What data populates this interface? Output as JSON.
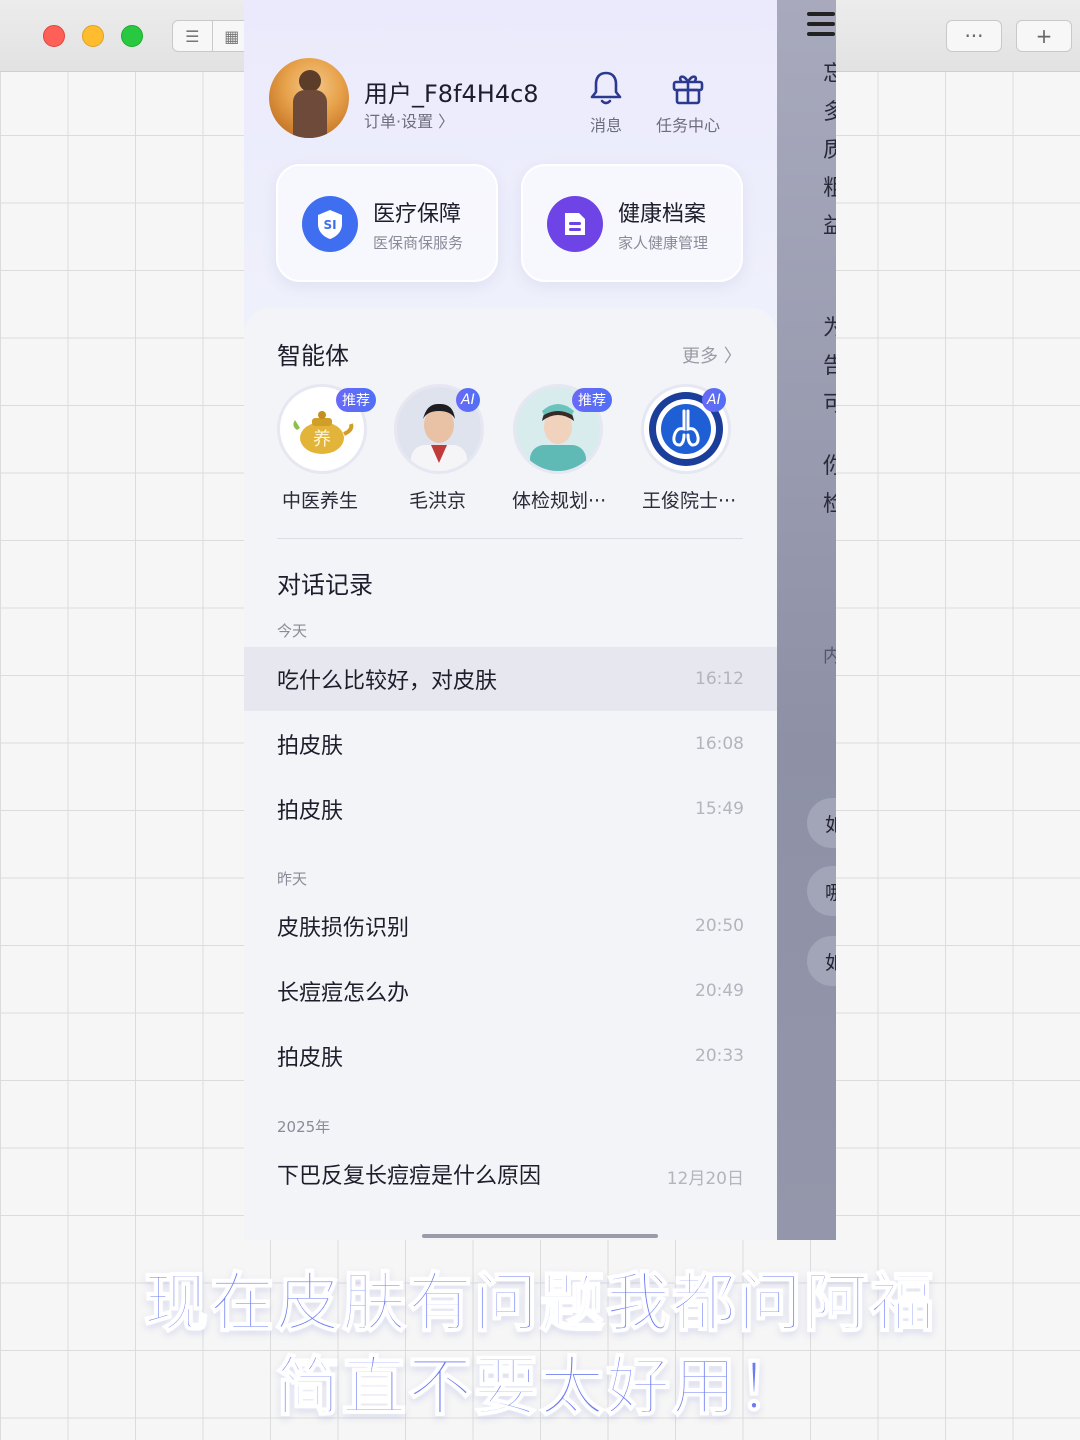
{
  "window": {
    "more_label": "···",
    "plus_label": "+"
  },
  "profile": {
    "username": "用户_F8f4H4c8",
    "subline": "订单·设置 〉",
    "messages_label": "消息",
    "tasks_label": "任务中心"
  },
  "cards": [
    {
      "title": "医疗保障",
      "subtitle": "医保商保服务",
      "icon": "si-shield-icon",
      "color": "#3f6ff0",
      "icon_text": "SI"
    },
    {
      "title": "健康档案",
      "subtitle": "家人健康管理",
      "icon": "file-icon",
      "color": "#6e44e6"
    }
  ],
  "agents_section": {
    "title": "智能体",
    "more": "更多 〉",
    "items": [
      {
        "name": "中医养生",
        "badge": "推荐",
        "icon": "teapot-icon",
        "icon_text": "养"
      },
      {
        "name": "毛洪京",
        "badge": "AI",
        "icon": "doctor-avatar-icon"
      },
      {
        "name": "体检规划···",
        "badge": "推荐",
        "icon": "nurse-avatar-icon"
      },
      {
        "name": "王俊院士···",
        "badge": "AI",
        "icon": "lung-logo-icon"
      }
    ]
  },
  "history": {
    "title": "对话记录",
    "groups": [
      {
        "label": "今天",
        "items": [
          {
            "title": "吃什么比较好，对皮肤",
            "time": "16:12"
          },
          {
            "title": "拍皮肤",
            "time": "16:08"
          },
          {
            "title": "拍皮肤",
            "time": "15:49"
          }
        ]
      },
      {
        "label": "昨天",
        "items": [
          {
            "title": "皮肤损伤识别",
            "time": "20:50"
          },
          {
            "title": "长痘痘怎么办",
            "time": "20:49"
          },
          {
            "title": "拍皮肤",
            "time": "20:33"
          }
        ]
      },
      {
        "label": "2025年",
        "items": [
          {
            "title": "下巴反复长痘痘是什么原因",
            "time": "12月20日"
          }
        ]
      }
    ]
  },
  "background_panel": {
    "chars": [
      "忘",
      "多",
      "质",
      "粗",
      "益",
      "为",
      "告",
      "可",
      "你",
      "检",
      "内"
    ],
    "pills": [
      "如",
      "哪",
      "如"
    ]
  },
  "caption": {
    "line1": "现在皮肤有问题我都问阿福",
    "line2": "简直不要太好用！"
  },
  "colors": {
    "accent": "#5a6ff3",
    "caption": "#6b7bf2"
  }
}
